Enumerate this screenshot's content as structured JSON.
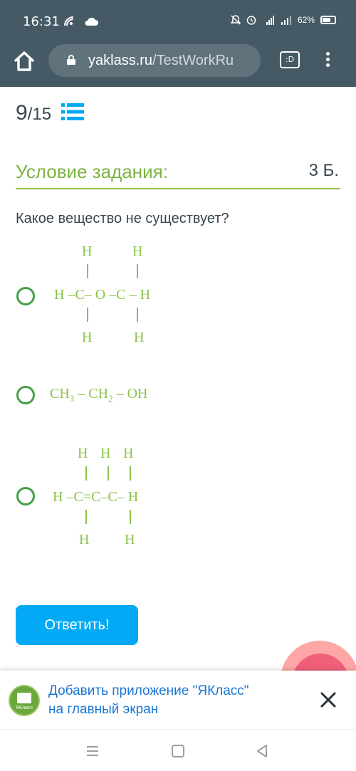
{
  "status_bar": {
    "time": "16:31",
    "battery": "62%",
    "icons": [
      "wifi-calling-icon",
      "cloud-icon",
      "dnd-icon",
      "alarm-icon",
      "signal-4g-icon",
      "signal-icon",
      "battery-icon"
    ]
  },
  "browser": {
    "url_host": "yaklass.ru",
    "url_path": "/TestWorkRu",
    "tab_label": ":D"
  },
  "progress": {
    "current": "9",
    "total": "/15"
  },
  "task": {
    "title": "Условие задания:",
    "points": "3 Б.",
    "question": "Какое вещество не существует?"
  },
  "options": [
    {
      "structure": {
        "top": [
          "H",
          "H"
        ],
        "middle": "H –C– O –C – H",
        "bottom": [
          "H",
          "H"
        ]
      }
    },
    {
      "formula": {
        "p1": "CH",
        "s1": "3",
        "p2": " – CH",
        "s2": "2",
        "p3": "  – OH"
      }
    },
    {
      "structure": {
        "top": [
          "H",
          "H",
          "H"
        ],
        "middle": "H –C=C–C– H",
        "bottom": [
          "H",
          "H"
        ]
      }
    }
  ],
  "answer_button": "Ответить!",
  "banner": {
    "logo_text": "ЯКласс",
    "text_line1": "Добавить приложение \"ЯКласс\"",
    "text_line2": "на главный экран"
  },
  "colors": {
    "header_bg": "#455a64",
    "accent_green": "#8bc34a",
    "radio_green": "#43a047",
    "button_blue": "#03a9f4",
    "link_blue": "#1976d2"
  }
}
